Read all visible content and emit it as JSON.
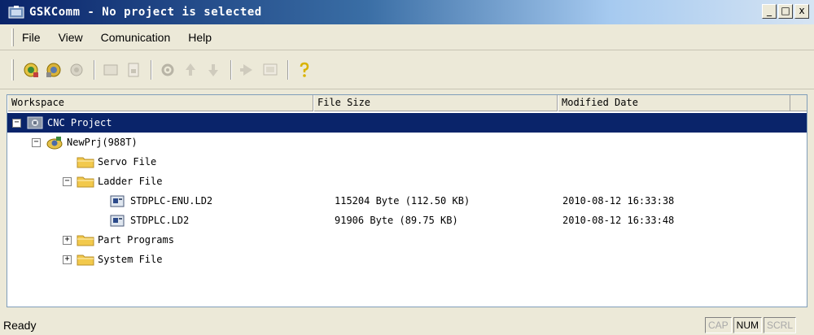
{
  "window": {
    "title": "GSKComm - No  project is selected",
    "controls": {
      "minimize": "_",
      "maximize": "□",
      "close": "x"
    }
  },
  "menu": {
    "items": [
      {
        "label": "File"
      },
      {
        "label": "View"
      },
      {
        "label": "Comunication"
      },
      {
        "label": "Help"
      }
    ]
  },
  "toolbar": {
    "buttons": [
      {
        "icon": "connect-icon",
        "enabled": true
      },
      {
        "icon": "disconnect-icon",
        "enabled": true
      },
      {
        "icon": "link-icon",
        "enabled": false
      },
      {
        "icon": "open-icon",
        "enabled": false
      },
      {
        "icon": "new-file-icon",
        "enabled": false
      },
      {
        "icon": "settings-icon",
        "enabled": false
      },
      {
        "icon": "upload-icon",
        "enabled": false
      },
      {
        "icon": "download-icon",
        "enabled": false
      },
      {
        "icon": "run-icon",
        "enabled": false
      },
      {
        "icon": "monitor-icon",
        "enabled": false
      },
      {
        "icon": "help-icon",
        "enabled": true
      }
    ]
  },
  "list": {
    "columns": [
      "Workspace",
      "File Size",
      "Modified Date"
    ],
    "rows": [
      {
        "label": "CNC Project",
        "icon": "cnc-project-icon",
        "level": 0,
        "expander": "−",
        "selected": true,
        "size": "",
        "date": ""
      },
      {
        "label": "NewPrj(988T)",
        "icon": "project-icon",
        "level": 1,
        "expander": "−",
        "selected": false,
        "size": "",
        "date": ""
      },
      {
        "label": "Servo File",
        "icon": "folder-icon",
        "level": 2,
        "expander": "",
        "selected": false,
        "size": "",
        "date": ""
      },
      {
        "label": "Ladder File",
        "icon": "folder-icon",
        "level": 2,
        "expander": "−",
        "selected": false,
        "size": "",
        "date": ""
      },
      {
        "label": "STDPLC-ENU.LD2",
        "icon": "ladder-file-icon",
        "level": 3,
        "expander": "",
        "selected": false,
        "size": "115204 Byte (112.50 KB)",
        "date": "2010-08-12  16:33:38"
      },
      {
        "label": "STDPLC.LD2",
        "icon": "ladder-file-icon",
        "level": 3,
        "expander": "",
        "selected": false,
        "size": "91906 Byte (89.75 KB)",
        "date": "2010-08-12  16:33:48"
      },
      {
        "label": "Part Programs",
        "icon": "folder-icon",
        "level": 2,
        "expander": "+",
        "selected": false,
        "size": "",
        "date": ""
      },
      {
        "label": "System File",
        "icon": "folder-icon",
        "level": 2,
        "expander": "+",
        "selected": false,
        "size": "",
        "date": ""
      }
    ]
  },
  "status": {
    "text": "Ready",
    "indicators": [
      {
        "label": "CAP",
        "active": false
      },
      {
        "label": "NUM",
        "active": true
      },
      {
        "label": "SCRL",
        "active": false
      }
    ]
  }
}
